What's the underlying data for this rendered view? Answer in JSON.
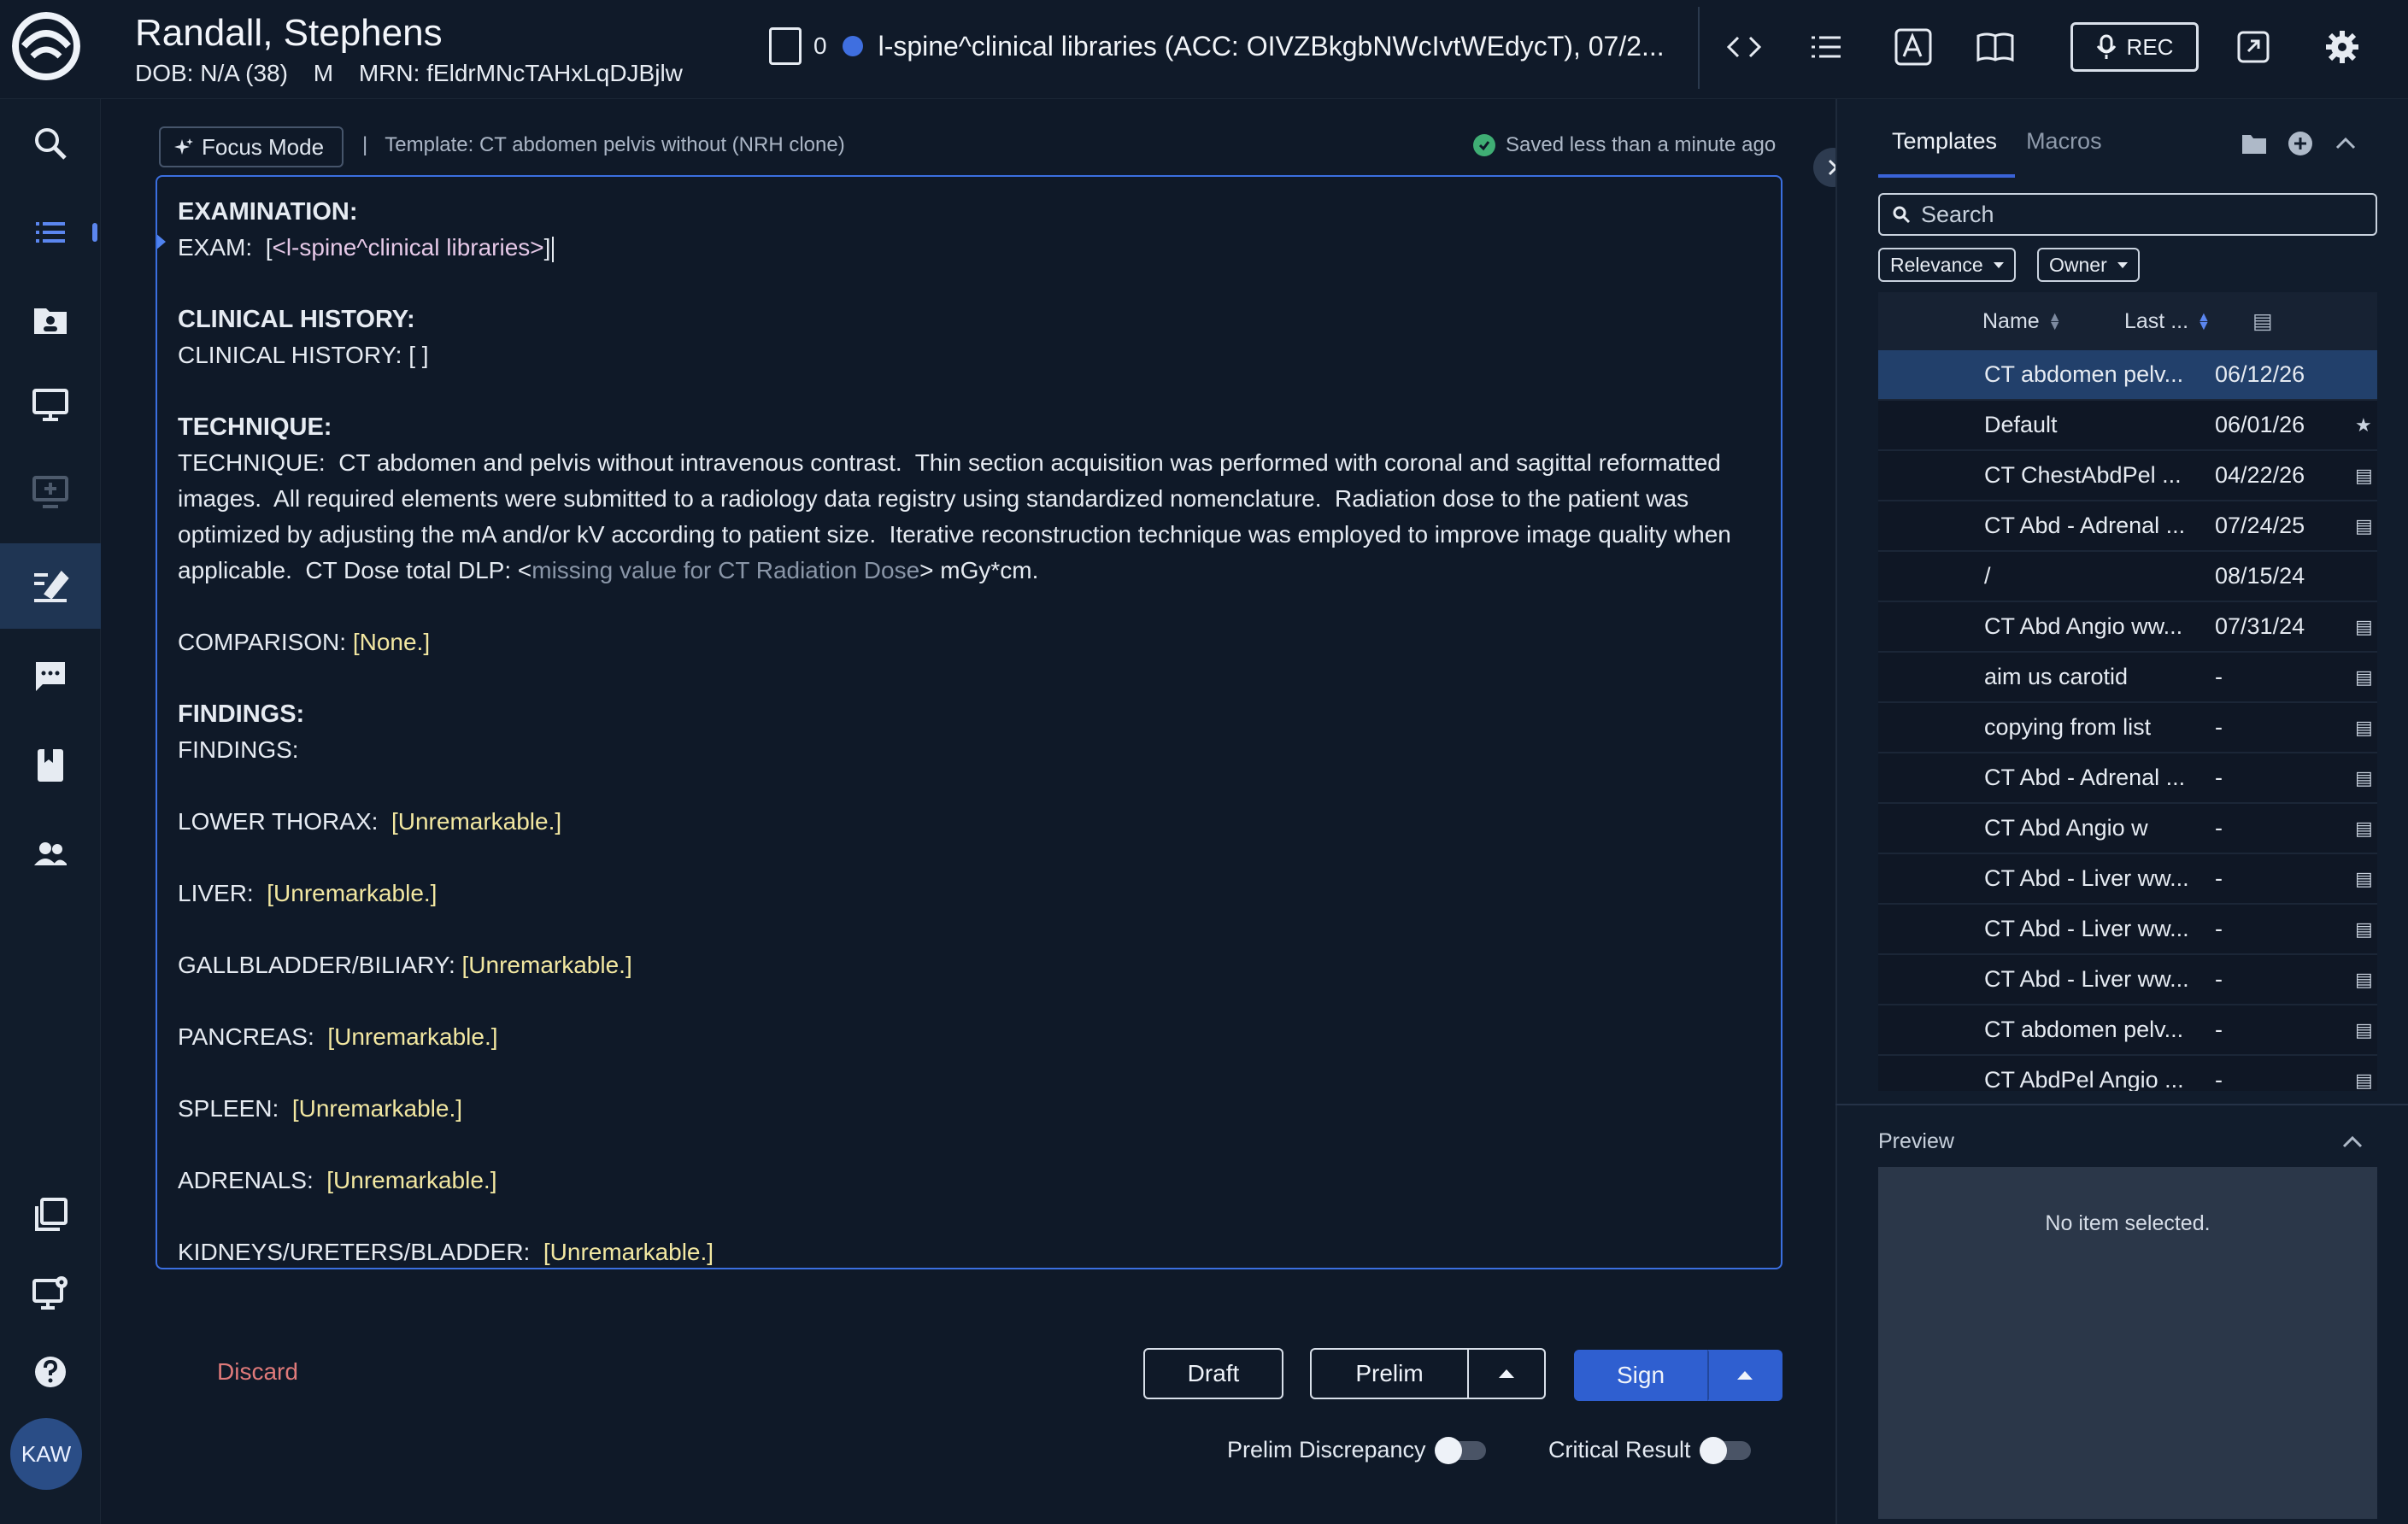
{
  "header": {
    "patient_name": "Randall, Stephens",
    "dob": "DOB: N/A (38)",
    "sex": "M",
    "mrn": "MRN: fEldrMNcTAHxLqDJBjlw",
    "attachment_count": "0",
    "study_title": "l-spine^clinical libraries (ACC: OIVZBkgbNWcIvtWEdycT), 07/2...",
    "rec_label": "REC"
  },
  "toolbar": {
    "focus_mode_label": "Focus Mode",
    "template_label": "Template: CT abdomen pelvis without (NRH clone)",
    "saved_status": "Saved less than a minute ago"
  },
  "report": {
    "exam_heading": "EXAMINATION:",
    "exam_prefix": "EXAM:  [",
    "exam_value": "<l-spine^clinical libraries>",
    "exam_suffix": "]",
    "history_heading": "CLINICAL HISTORY:",
    "history_line": "CLINICAL HISTORY: [ ]",
    "technique_heading": "TECHNIQUE:",
    "technique_text": "TECHNIQUE:  CT abdomen and pelvis without intravenous contrast.  Thin section acquisition was performed with coronal and sagittal reformatted images.  All required elements were submitted to a radiology data registry using standardized nomenclature.  Radiation dose to the patient was optimized by adjusting the mA and/or kV according to patient size.  Iterative reconstruction technique was employed to improve image quality when applicable.  CT Dose total DLP: <",
    "technique_missing": "missing value for CT Radiation Dose",
    "technique_end": "> mGy*cm.",
    "comparison_label": "COMPARISON: ",
    "comparison_value": "[None.]",
    "findings_heading": "FINDINGS:",
    "findings_line": "FINDINGS:",
    "findings": [
      {
        "label": "LOWER THORAX:  ",
        "value": "[Unremarkable.]"
      },
      {
        "label": "LIVER:  ",
        "value": "[Unremarkable.]"
      },
      {
        "label": "GALLBLADDER/BILIARY: ",
        "value": "[Unremarkable.]"
      },
      {
        "label": "PANCREAS:  ",
        "value": "[Unremarkable.]"
      },
      {
        "label": "SPLEEN:  ",
        "value": "[Unremarkable.]"
      },
      {
        "label": "ADRENALS:  ",
        "value": "[Unremarkable.]"
      },
      {
        "label": "KIDNEYS/URETERS/BLADDER:  ",
        "value": "[Unremarkable.]"
      }
    ]
  },
  "actions": {
    "discard": "Discard",
    "draft": "Draft",
    "prelim": "Prelim",
    "sign": "Sign",
    "prelim_discrepancy": "Prelim Discrepancy",
    "critical_result": "Critical Result"
  },
  "side_panel": {
    "tabs": [
      "Templates",
      "Macros"
    ],
    "search_placeholder": "Search",
    "filters": [
      "Relevance",
      "Owner"
    ],
    "columns": [
      "Name",
      "Last ..."
    ],
    "rows": [
      {
        "name": "CT abdomen pelv...",
        "last": "06/12/26"
      },
      {
        "name": "Default",
        "last": "06/01/26"
      },
      {
        "name": "CT ChestAbdPel ...",
        "last": "04/22/26"
      },
      {
        "name": "CT Abd - Adrenal ...",
        "last": "07/24/25"
      },
      {
        "name": "/",
        "last": "08/15/24"
      },
      {
        "name": "CT Abd Angio ww...",
        "last": "07/31/24"
      },
      {
        "name": "aim us carotid",
        "last": "-"
      },
      {
        "name": "copying from list",
        "last": "-"
      },
      {
        "name": "CT Abd - Adrenal ...",
        "last": "-"
      },
      {
        "name": "CT Abd Angio w",
        "last": "-"
      },
      {
        "name": "CT Abd - Liver ww...",
        "last": "-"
      },
      {
        "name": "CT Abd - Liver ww...",
        "last": "-"
      },
      {
        "name": "CT Abd - Liver ww...",
        "last": "-"
      },
      {
        "name": "CT abdomen pelv...",
        "last": "-"
      },
      {
        "name": "CT AbdPel Angio ...",
        "last": "-"
      }
    ],
    "preview_label": "Preview",
    "preview_empty": "No item selected."
  },
  "user": {
    "initials": "KAW"
  },
  "colors": {
    "accent": "#3a63d8",
    "sign_button": "#2f5fd0",
    "discard": "#e07a7a",
    "saved_check": "#3fae74"
  }
}
